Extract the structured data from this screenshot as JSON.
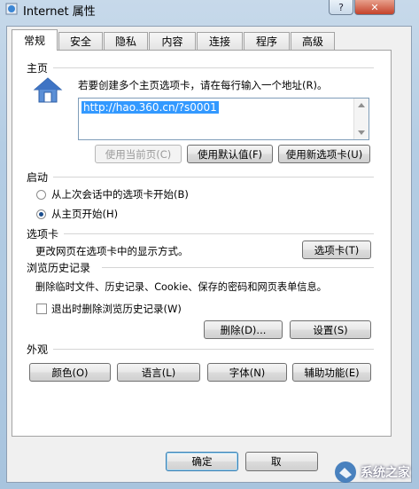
{
  "window": {
    "title": "Internet 属性"
  },
  "tabs": [
    {
      "label": "常规"
    },
    {
      "label": "安全"
    },
    {
      "label": "隐私"
    },
    {
      "label": "内容"
    },
    {
      "label": "连接"
    },
    {
      "label": "程序"
    },
    {
      "label": "高级"
    }
  ],
  "home": {
    "heading": "主页",
    "instruction": "若要创建多个主页选项卡，请在每行输入一个地址(R)。",
    "url": "http://hao.360.cn/?s0001",
    "btn_current": "使用当前页(C)",
    "btn_default": "使用默认值(F)",
    "btn_newtab": "使用新选项卡(U)"
  },
  "startup": {
    "heading": "启动",
    "option_last": "从上次会话中的选项卡开始(B)",
    "option_home": "从主页开始(H)",
    "selected": "option_home"
  },
  "tabs_section": {
    "heading": "选项卡",
    "desc": "更改网页在选项卡中的显示方式。",
    "btn": "选项卡(T)"
  },
  "history": {
    "heading": "浏览历史记录",
    "desc": "删除临时文件、历史记录、Cookie、保存的密码和网页表单信息。",
    "checkbox_label": "退出时删除浏览历史记录(W)",
    "checked": false,
    "btn_delete": "删除(D)...",
    "btn_settings": "设置(S)"
  },
  "appearance": {
    "heading": "外观",
    "btn_colors": "颜色(O)",
    "btn_languages": "语言(L)",
    "btn_fonts": "字体(N)",
    "btn_accessibility": "辅助功能(E)"
  },
  "footer": {
    "ok": "确定",
    "cancel": "取"
  },
  "watermark": {
    "text": "系统之家"
  },
  "colors": {
    "accent": "#3399ff",
    "title_bg": "#b4cde4"
  }
}
